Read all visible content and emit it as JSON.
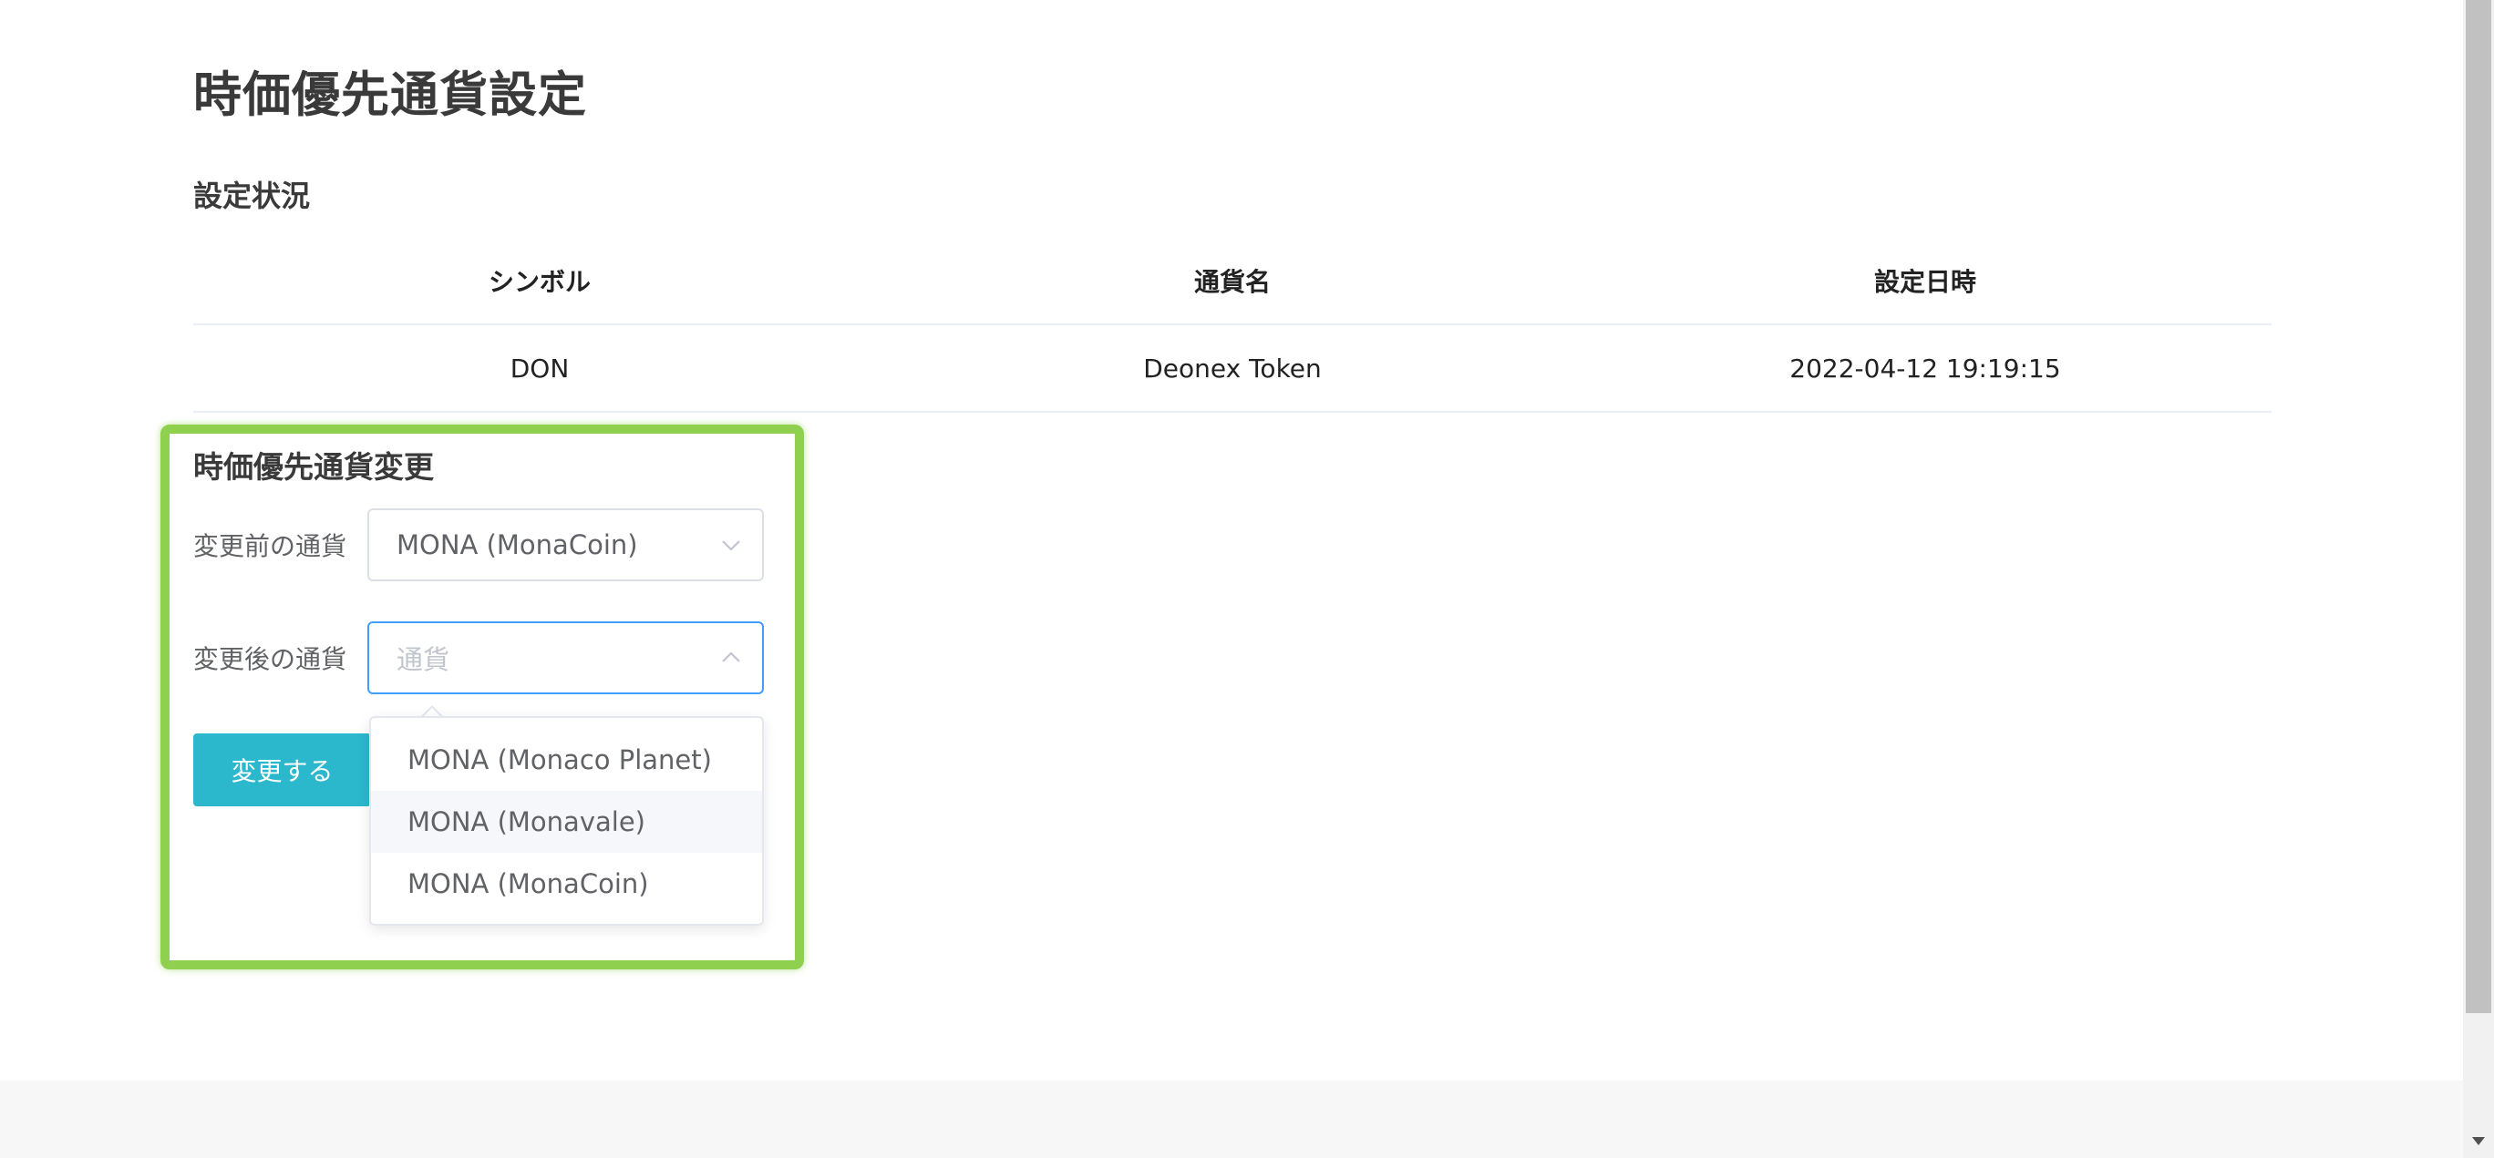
{
  "page": {
    "title": "時価優先通貨設定"
  },
  "status": {
    "section_title": "設定状況",
    "columns": [
      "シンボル",
      "通貨名",
      "設定日時"
    ],
    "rows": [
      [
        "DON",
        "Deonex Token",
        "2022-04-12 19:19:15"
      ]
    ]
  },
  "change_form": {
    "title": "時価優先通貨変更",
    "before_label": "変更前の通貨",
    "before_value": "MONA (MonaCoin)",
    "after_label": "変更後の通貨",
    "after_placeholder": "通貨",
    "submit_label": "変更する",
    "options": [
      "MONA (Monaco Planet)",
      "MONA (Monavale)",
      "MONA (MonaCoin)"
    ],
    "hovered_option": "MONA (Monavale)"
  },
  "colors": {
    "accent": "#2bb8cc",
    "focus_border": "#409eff",
    "highlight": "#8fd14f"
  },
  "icons": {
    "before_select_arrow": "chevron-down-icon",
    "after_select_arrow": "chevron-up-icon"
  }
}
